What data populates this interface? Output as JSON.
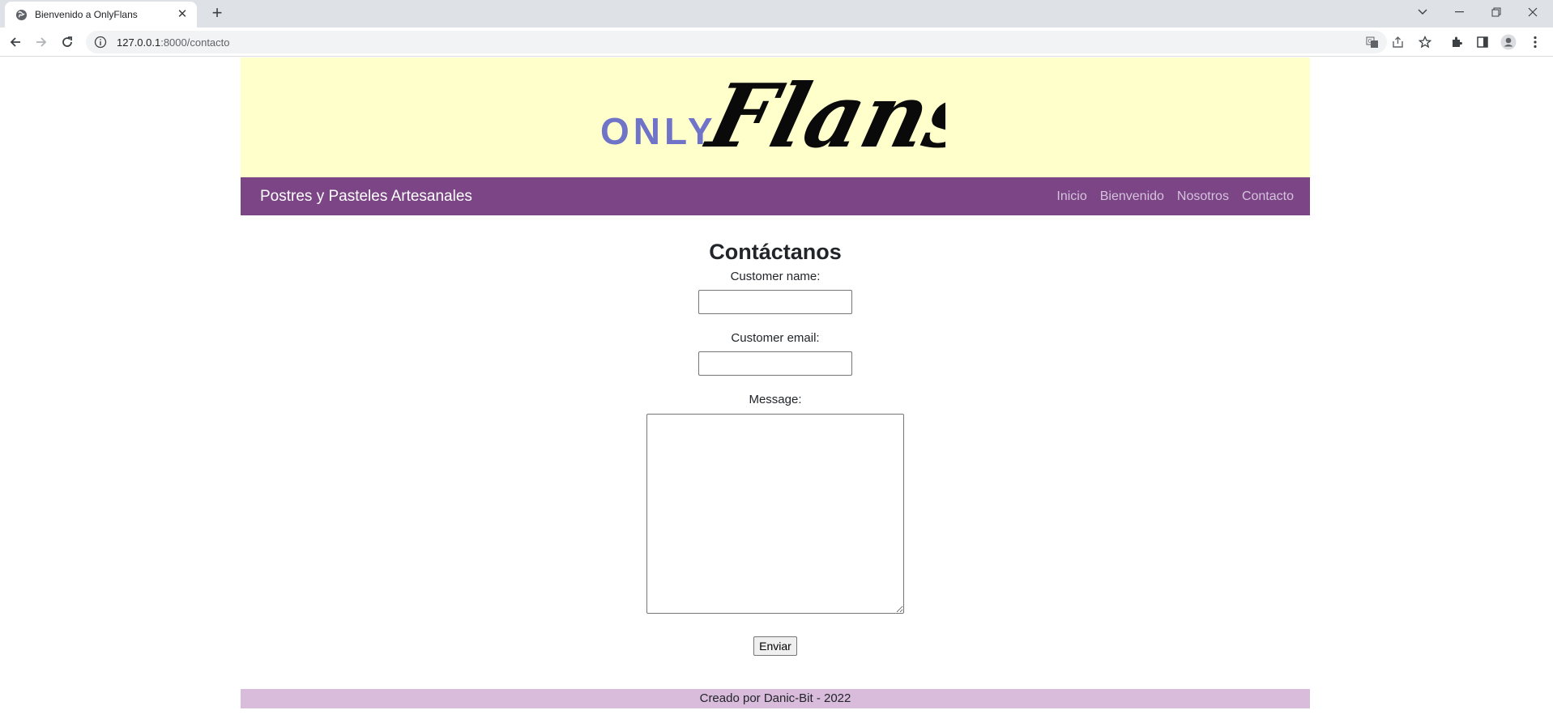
{
  "browser": {
    "tab_title": "Bienvenido a OnlyFlans",
    "url_host": "127.0.0.1",
    "url_path": ":8000/contacto"
  },
  "site": {
    "logo_small": "ONLY",
    "logo_script": "Flans",
    "brand": "Postres y Pasteles Artesanales",
    "nav": [
      "Inicio",
      "Bienvenido",
      "Nosotros",
      "Contacto"
    ],
    "colors": {
      "hero": "#ffffcc",
      "navbar": "#7b4586",
      "footer": "#d9bbdc",
      "logo_only": "#6f74c9"
    }
  },
  "form": {
    "title": "Contáctanos",
    "name_label": "Customer name:",
    "email_label": "Customer email:",
    "message_label": "Message:",
    "submit_label": "Enviar",
    "name_value": "",
    "email_value": "",
    "message_value": ""
  },
  "footer": {
    "text": "Creado por Danic-Bit - 2022"
  }
}
